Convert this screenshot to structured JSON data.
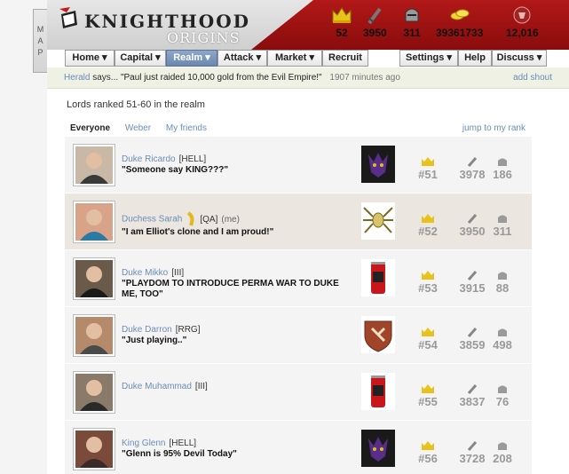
{
  "map_tab": {
    "letters": [
      "M",
      "A",
      "P"
    ]
  },
  "header": {
    "title": "KNIGHTHOOD",
    "subtitle": "ORIGINS",
    "stats": [
      {
        "icon": "crown-icon",
        "value": "52"
      },
      {
        "icon": "sword-icon",
        "value": "3950"
      },
      {
        "icon": "knight-helmet-icon",
        "value": "311"
      },
      {
        "icon": "gold-coins-icon",
        "value": "39361733"
      },
      {
        "icon": "shield-crest-icon",
        "value": "12,016"
      }
    ]
  },
  "nav": {
    "home": "Home",
    "capital": "Capital",
    "realm": "Realm",
    "attack": "Attack",
    "market": "Market",
    "recruit": "Recruit",
    "settings": "Settings",
    "help": "Help",
    "discuss": "Discuss"
  },
  "shout": {
    "herald": "Herald",
    "says": "says...",
    "message": "\"Paul just raided 10,000 gold from the Evil Empire!\"",
    "ago": "1907 minutes ago",
    "add": "add shout"
  },
  "lords_title": "Lords ranked 51-60 in the realm",
  "filters": {
    "everyone": "Everyone",
    "weber": "Weber",
    "friends": "My friends",
    "jump": "jump to my rank"
  },
  "lords": [
    {
      "name": "Duke Ricardo",
      "clan": "[HELL]",
      "me": "",
      "quote": "\"Someone say KING???\"",
      "quote2": "",
      "rank": "#51",
      "land": "3978",
      "army": "186",
      "badge": "demon",
      "me_row": false
    },
    {
      "name": "Duchess Sarah",
      "clan": "[QA]",
      "me": "(me)",
      "quote": "\"I am Elliot's clone and I am proud!\"",
      "quote2": "",
      "rank": "#52",
      "land": "3950",
      "army": "311",
      "badge": "spider",
      "me_row": true
    },
    {
      "name": "Duke Mikko",
      "clan": "[III]",
      "me": "",
      "quote": "\"PLAYDOM TO INTRODUCE PERMA WAR TO DUKE",
      "quote2": "ME, TOO\"",
      "rank": "#53",
      "land": "3915",
      "army": "88",
      "badge": "can",
      "me_row": false
    },
    {
      "name": "Duke Darron",
      "clan": "[RRG]",
      "me": "",
      "quote": "\"Just playing..\"",
      "quote2": "",
      "rank": "#54",
      "land": "3859",
      "army": "498",
      "badge": "shield",
      "me_row": false
    },
    {
      "name": "Duke Muhammad",
      "clan": "[III]",
      "me": "",
      "quote": "",
      "quote2": "",
      "rank": "#55",
      "land": "3837",
      "army": "76",
      "badge": "can",
      "me_row": false
    },
    {
      "name": "King Glenn",
      "clan": "[HELL]",
      "me": "",
      "quote": "\"Glenn is 95% Devil Today\"",
      "quote2": "",
      "rank": "#56",
      "land": "3728",
      "army": "208",
      "badge": "demon",
      "me_row": false
    }
  ]
}
